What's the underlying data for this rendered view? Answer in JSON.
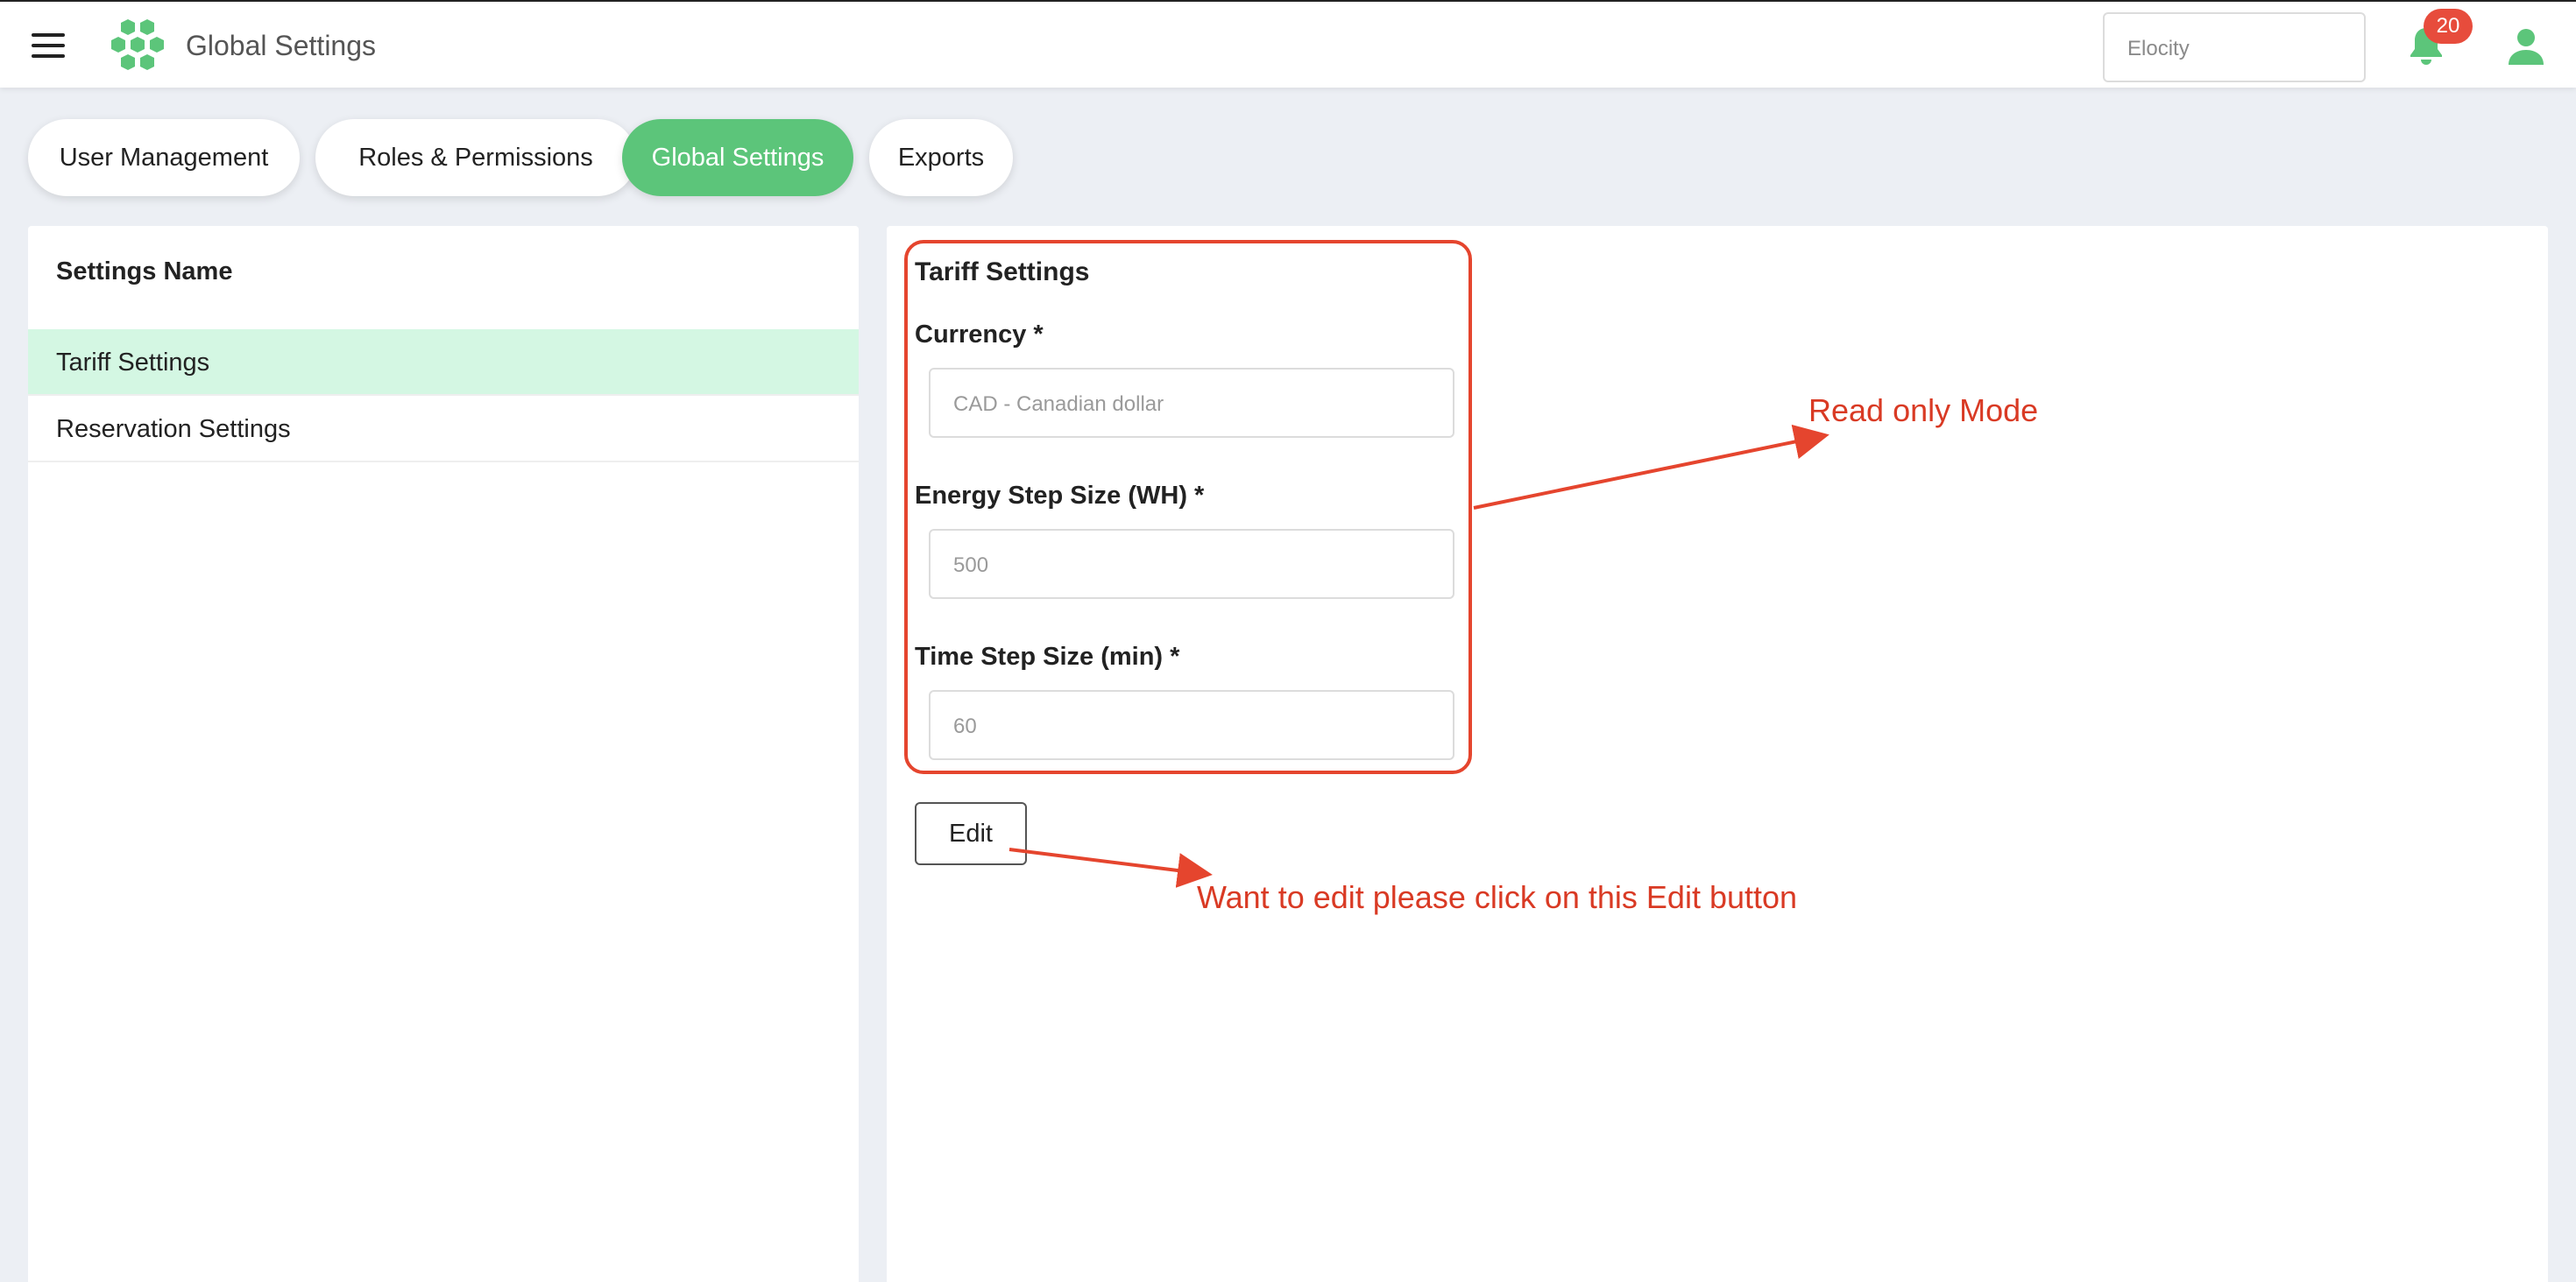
{
  "header": {
    "app_title": "Global Settings",
    "tenant_value": "Elocity",
    "notification_count": "20",
    "brand_color": "#5cc57a"
  },
  "tabs": [
    {
      "label": "User Management",
      "active": false
    },
    {
      "label": "Roles & Permissions",
      "active": false
    },
    {
      "label": "Global Settings",
      "active": true
    },
    {
      "label": "Exports",
      "active": false
    }
  ],
  "sidebar": {
    "header": "Settings Name",
    "items": [
      {
        "label": "Tariff Settings",
        "active": true
      },
      {
        "label": "Reservation Settings",
        "active": false
      }
    ]
  },
  "form": {
    "title": "Tariff Settings",
    "currency": {
      "label": "Currency *",
      "value": "CAD - Canadian dollar"
    },
    "energy_step": {
      "label": "Energy Step Size (WH) *",
      "value": "500"
    },
    "time_step": {
      "label": "Time Step Size (min) *",
      "value": "60"
    },
    "edit_label": "Edit"
  },
  "annotations": {
    "read_only": "Read only Mode",
    "edit_hint": "Want to edit please click on this Edit button",
    "color": "#e5452e"
  }
}
